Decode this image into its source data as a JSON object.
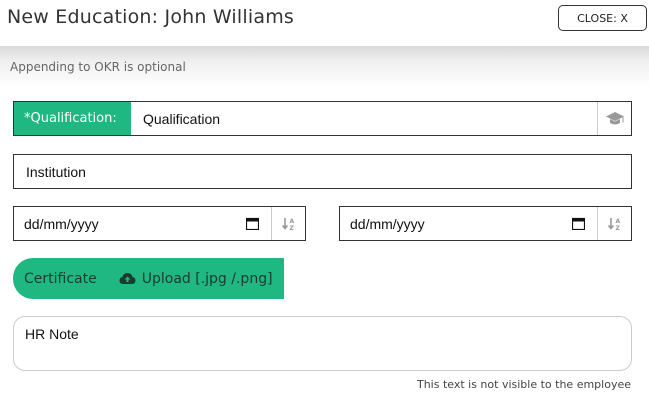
{
  "window": {
    "title": "New Education: John Williams",
    "close_label": "CLOSE: X"
  },
  "banner": {
    "text": "Appending to OKR is optional"
  },
  "form": {
    "qualification": {
      "label": "*Qualification:",
      "value": "Qualification",
      "icon": "graduation-cap-icon"
    },
    "institution": {
      "value": "Institution"
    },
    "start_date": {
      "value": "dd/mm/yyyy",
      "icons": [
        "calendar-icon",
        "sort-icon"
      ]
    },
    "end_date": {
      "value": "dd/mm/yyyy",
      "icons": [
        "calendar-icon",
        "sort-icon"
      ]
    },
    "certificate": {
      "label": "Certificate",
      "upload_label": "Upload [.jpg /.png]",
      "icon": "cloud-upload-icon"
    },
    "hr_note": {
      "value": "HR Note",
      "hint": "This text is not visible to the employee"
    }
  },
  "colors": {
    "accent": "#1fb883",
    "border": "#333333"
  }
}
